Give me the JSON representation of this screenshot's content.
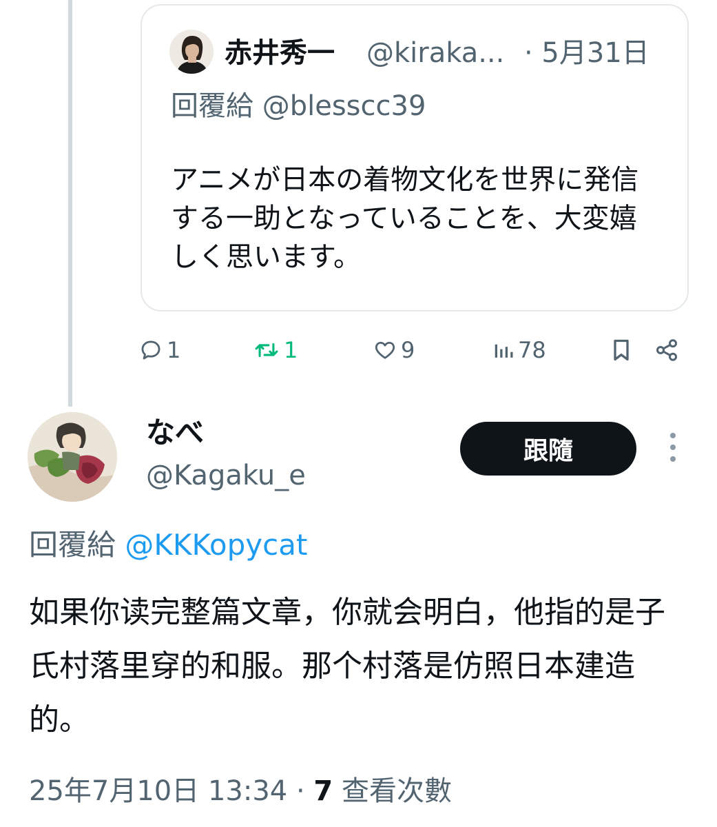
{
  "quoted_tweet": {
    "author_name": "赤井秀一",
    "author_handle": "@kiraka...",
    "date": "· 5月31日",
    "reply_prefix": "回覆給",
    "reply_to": "@blesscc39",
    "body": "アニメが日本の着物文化を世界に発信する一助となっていることを、大変嬉しく思います。"
  },
  "actions": {
    "reply_icon": "reply-icon",
    "reply_count": "1",
    "retweet_icon": "retweet-icon",
    "retweet_count": "1",
    "like_icon": "heart-icon",
    "like_count": "9",
    "views_icon": "views-icon",
    "views_count": "78",
    "bookmark_icon": "bookmark-icon",
    "share_icon": "share-icon"
  },
  "main_tweet": {
    "author_name": "なべ",
    "author_handle": "@Kagaku_e",
    "follow_label": "跟隨",
    "reply_prefix": "回覆給",
    "reply_to": "@KKKopycat",
    "body": "如果你读完整篇文章，你就会明白，他指的是子氏村落里穿的和服。那个村落是仿照日本建造的。",
    "timestamp": "25年7月10日 13:34 ·",
    "view_count": "7",
    "view_label": "查看次數"
  },
  "colors": {
    "text": "#0f1419",
    "secondary": "#536471",
    "link": "#1d9bf0",
    "retweet_green": "#00ba7c",
    "button_bg": "#0f1419",
    "border": "#e4e8ea",
    "thread_line": "#cfd9de"
  }
}
